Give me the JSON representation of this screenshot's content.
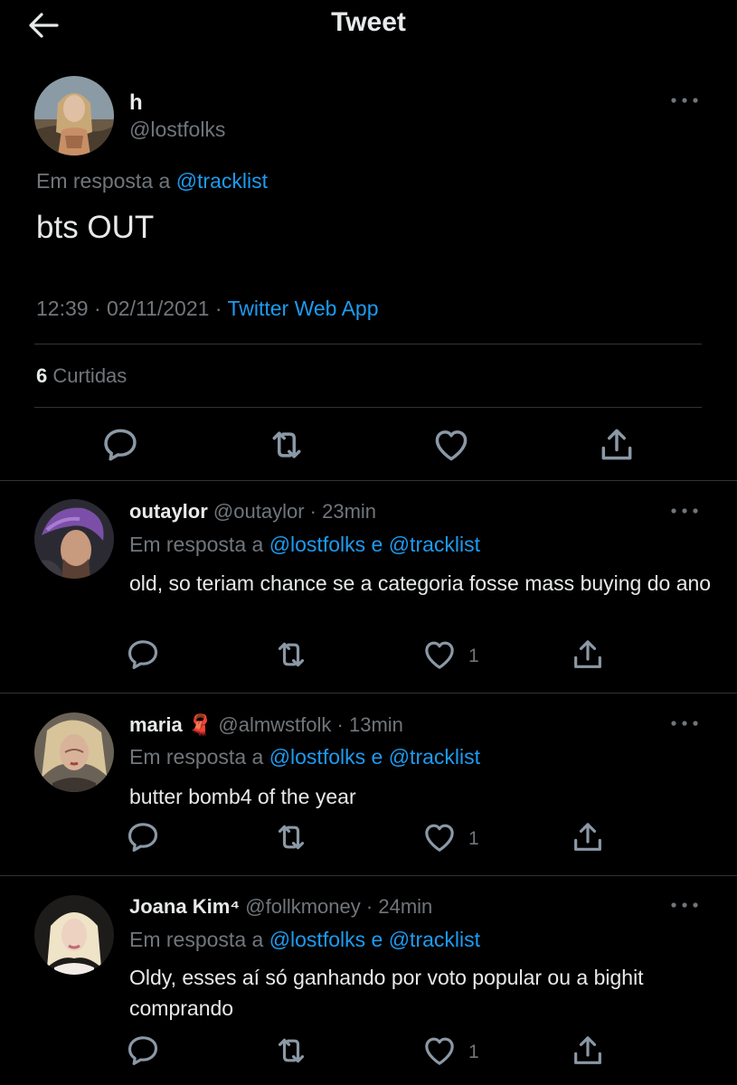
{
  "header": {
    "title": "Tweet"
  },
  "tweet": {
    "name": "h",
    "handle": "@lostfolks",
    "reply_prefix": "Em resposta a",
    "reply_to": "@tracklist",
    "text": "bts OUT",
    "time": "12:39",
    "date": "02/11/2021",
    "sep": "·",
    "source": "Twitter Web App",
    "likes_count": "6",
    "likes_label": "Curtidas"
  },
  "replies": [
    {
      "name": "outaylor",
      "emoji": "",
      "handle": "@outaylor",
      "time": "23min",
      "reply_prefix": "Em resposta a",
      "reply_to_1": "@lostfolks",
      "joiner": "e",
      "reply_to_2": "@tracklist",
      "text": "old, so teriam chance se a categoria fosse mass buying do ano",
      "like_count": "1"
    },
    {
      "name": "maria",
      "emoji": "🧣",
      "handle": "@almwstfolk",
      "time": "13min",
      "reply_prefix": "Em resposta a",
      "reply_to_1": "@lostfolks",
      "joiner": "e",
      "reply_to_2": "@tracklist",
      "text": "butter bomb4 of the year",
      "like_count": "1"
    },
    {
      "name": "Joana Kim⁴",
      "emoji": "",
      "handle": "@follkmoney",
      "time": "24min",
      "reply_prefix": "Em resposta a",
      "reply_to_1": "@lostfolks",
      "joiner": "e",
      "reply_to_2": "@tracklist",
      "text": "Oldy, esses aí só ganhando por voto popular ou a bighit comprando",
      "like_count": "1"
    }
  ],
  "icons": {
    "back": "arrow-left-icon",
    "more": "more-dots-icon",
    "reply": "reply-icon",
    "retweet": "retweet-icon",
    "like": "heart-icon",
    "share": "share-icon"
  },
  "colors": {
    "background": "#000000",
    "text": "#e7e9ea",
    "secondary": "#71767b",
    "link": "#1d9bf0",
    "divider": "#2f3336"
  }
}
